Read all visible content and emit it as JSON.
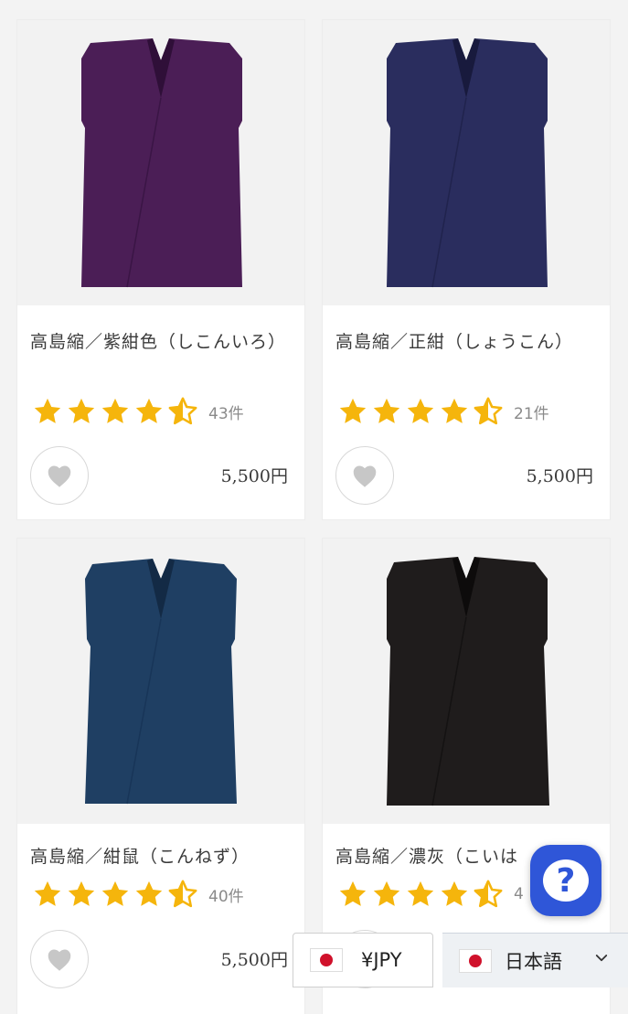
{
  "products": [
    {
      "title": "高島縮／紫紺色（しこんいろ）",
      "rating": 4.5,
      "review_count": "43件",
      "price": "5,500円",
      "color": "#4b1e56"
    },
    {
      "title": "高島縮／正紺（しょうこん）",
      "rating": 4.5,
      "review_count": "21件",
      "price": "5,500円",
      "color": "#2a2d5e"
    },
    {
      "title": "高島縮／紺鼠（こんねず）",
      "rating": 4.5,
      "review_count": "40件",
      "price": "5,500円",
      "color": "#1f3f63"
    },
    {
      "title": "高島縮／濃灰（こいは",
      "rating": 4.5,
      "review_count": "4",
      "price": "",
      "color": "#1f1c1c"
    }
  ],
  "currency_selector": {
    "label": "¥JPY"
  },
  "language_selector": {
    "label": "日本語"
  },
  "help_button": {
    "label": "?"
  },
  "icons": {
    "favorite": "heart-icon",
    "star": "star-icon",
    "flag": "japan-flag-icon",
    "chevron": "chevron-down-icon"
  },
  "colors": {
    "star": "#f5b50c",
    "help_button": "#2f56d8"
  }
}
